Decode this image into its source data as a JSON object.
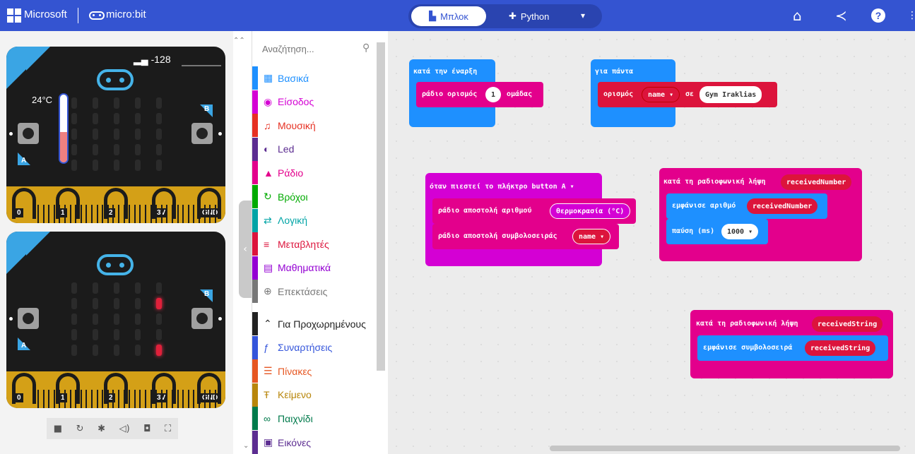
{
  "header": {
    "microsoft": "Microsoft",
    "microbit": "micro:bit",
    "tab_blocks": "Μπλοκ",
    "tab_python": "Python",
    "icons": [
      "home-icon",
      "share-icon",
      "help-icon"
    ]
  },
  "sim": {
    "signal": "-128",
    "temperature": "24°C",
    "temperature_fill": 0.45
  },
  "toolbox": {
    "search_placeholder": "Αναζήτηση...",
    "categories": [
      {
        "label": "Βασικά",
        "color": "#1e90ff",
        "icon": "▦"
      },
      {
        "label": "Είσοδος",
        "color": "#d400d4",
        "icon": "◉"
      },
      {
        "label": "Μουσική",
        "color": "#e63022",
        "icon": "♫"
      },
      {
        "label": "Led",
        "color": "#5c2d91",
        "icon": "◐"
      },
      {
        "label": "Ράδιο",
        "color": "#e3008c",
        "icon": "▲"
      },
      {
        "label": "Βρόχοι",
        "color": "#00aa00",
        "icon": "↻"
      },
      {
        "label": "Λογική",
        "color": "#00a4a6",
        "icon": "⇄"
      },
      {
        "label": "Μεταβλητές",
        "color": "#dc143c",
        "icon": "≡"
      },
      {
        "label": "Μαθηματικά",
        "color": "#9400d3",
        "icon": "▤"
      },
      {
        "label": "Επεκτάσεις",
        "color": "#777777",
        "icon": "⊕"
      },
      {
        "label": "Για Προχωρημένους",
        "color": "#222222",
        "icon": "⌃"
      },
      {
        "label": "Συναρτήσεις",
        "color": "#3455db",
        "icon": "ƒ"
      },
      {
        "label": "Πίνακες",
        "color": "#e65722",
        "icon": "☰"
      },
      {
        "label": "Κείμενο",
        "color": "#b8860b",
        "icon": "Ŧ"
      },
      {
        "label": "Παιχνίδι",
        "color": "#007a4b",
        "icon": "∞"
      },
      {
        "label": "Εικόνες",
        "color": "#5c2d91",
        "icon": "▣"
      }
    ]
  },
  "blocks": {
    "on_start": "κατά την έναρξη",
    "radio_group": "ράδιο ορισμός",
    "radio_group_value": "1",
    "radio_group_suffix": "ομάδας",
    "forever": "για πάντα",
    "set": "ορισμός",
    "set_var": "name ▾",
    "set_to": "σε",
    "set_value": "Gym Iraklias",
    "on_button": "όταν πιεστεί το πλήκτρο button  A ▾",
    "send_number": "ράδιο αποστολή αριθμού",
    "send_number_value": "θερμοκρασία (°C)",
    "send_string": "ράδιο αποστολή συμβολοσειράς",
    "send_string_value": "name ▾",
    "on_received_number": "κατά τη ραδιοφωνική λήψη",
    "received_number": "receivedNumber",
    "show_number": "εμφάνισε αριθμό",
    "pause": "παύση (ms)",
    "pause_value": "1000 ▾",
    "on_received_string": "κατά τη ραδιοφωνική λήψη",
    "received_string": "receivedString",
    "show_string": "εμφάνισε συμβολοσειρά"
  },
  "colors": {
    "header": "#3454d1",
    "basic": "#1e90ff",
    "radio": "#e3008c",
    "input": "#d400d4",
    "variables": "#dc143c"
  }
}
